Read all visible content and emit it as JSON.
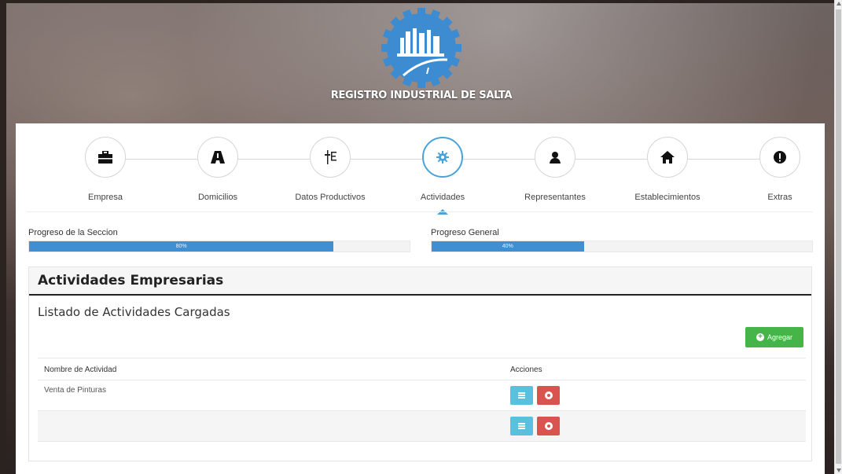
{
  "brand": {
    "title": "REGISTRO INDUSTRIAL DE SALTA"
  },
  "colors": {
    "accent": "#4aa3d8",
    "progress": "#3f8fd2",
    "success": "#45b549",
    "info": "#5bc0de",
    "danger": "#d9534f"
  },
  "steps": [
    {
      "label": "Empresa",
      "icon": "briefcase-icon"
    },
    {
      "label": "Domicilios",
      "icon": "road-icon"
    },
    {
      "label": "Datos Productivos",
      "icon": "sliders-icon"
    },
    {
      "label": "Actividades",
      "icon": "gear-icon",
      "active": true
    },
    {
      "label": "Representantes",
      "icon": "user-icon"
    },
    {
      "label": "Establecimientos",
      "icon": "home-icon"
    },
    {
      "label": "Extras",
      "icon": "exclamation-icon"
    }
  ],
  "progress": {
    "section": {
      "label": "Progreso de la Seccion",
      "value_text": "80%",
      "value": 80
    },
    "general": {
      "label": "Progreso General",
      "value_text": "40%",
      "value": 40
    }
  },
  "section": {
    "title": "Actividades Empresarias",
    "subtitle": "Listado de Actividades Cargadas",
    "add_label": "Agregar"
  },
  "table": {
    "headers": [
      "Nombre de Actividad",
      "Acciones"
    ],
    "rows": [
      {
        "name": "Venta de Pinturas"
      },
      {
        "name": ""
      }
    ]
  }
}
